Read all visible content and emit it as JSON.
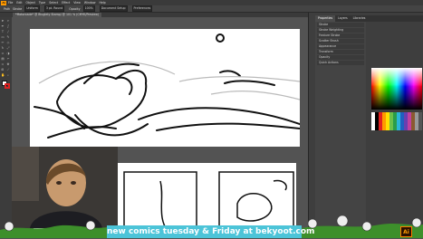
{
  "app": {
    "logo_text": "Ai",
    "menu": [
      "File",
      "Edit",
      "Object",
      "Type",
      "Select",
      "Effect",
      "View",
      "Window",
      "Help"
    ]
  },
  "control_bar": {
    "items": [
      "Path",
      "Stroke",
      "Uniform",
      "3 pt. Round",
      "Opacity",
      "100%",
      "Document Setup",
      "Preferences"
    ]
  },
  "document": {
    "tab_label": "*Motorcade* @ Bluglety Stamp/ @ 101 % (CMYK/Preview)"
  },
  "right_panel": {
    "tabs": [
      "Properties",
      "Layers",
      "Libraries"
    ],
    "active_tab": "Properties",
    "rows": [
      "Stroke",
      "Stroke Weighting",
      "Feature Stroke",
      "Scatter Brush",
      "Appearance",
      "Transform",
      "Opacity",
      "Quick Actions"
    ]
  },
  "banner": {
    "text": "new comics tuesday & Friday at bekyoot.com"
  },
  "colors": {
    "banner": "#4cc4d8",
    "accent_orange": "#ff9a00",
    "stroke_red": "#e02020"
  }
}
